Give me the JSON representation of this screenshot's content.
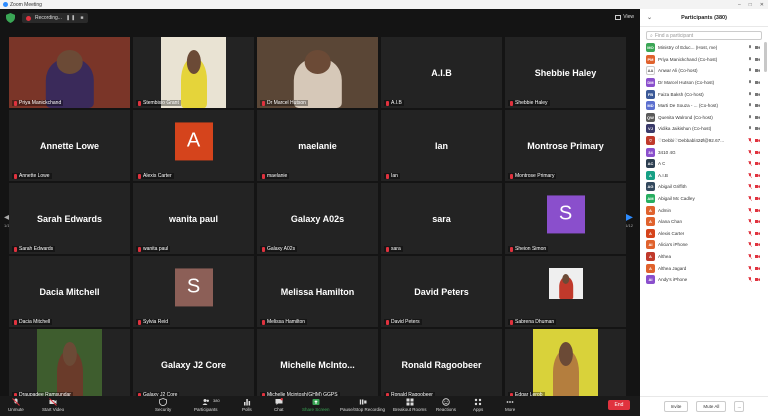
{
  "window": {
    "title": "Zoom Meeting"
  },
  "meeting": {
    "recording_label": "Recording...",
    "view_label": "View",
    "prev_page": "1/12",
    "next_page": "1/12"
  },
  "tiles": [
    {
      "name": "Priya Manickchand",
      "type": "photo",
      "active": true,
      "photo_bg": "#7a3528",
      "photo_fg": "#3a2a5a"
    },
    {
      "name": "Stembisio Grant",
      "type": "photo",
      "photo_bg": "#e9e3d3",
      "photo_fg": "#e5d43a"
    },
    {
      "name": "Dr Marcel Hutson",
      "type": "photo",
      "photo_bg": "#5a4636",
      "photo_fg": "#d6c8b8"
    },
    {
      "name": "A.I.B",
      "big": "A.I.B",
      "type": "text"
    },
    {
      "name": "Shebbie Haley",
      "big": "Shebbie Haley",
      "type": "text"
    },
    {
      "name": "Annette Lowe",
      "big": "Annette Lowe",
      "type": "text"
    },
    {
      "name": "Alexis Carter",
      "type": "avatar",
      "letter": "A",
      "color": "#d5441c"
    },
    {
      "name": "maelanie",
      "big": "maelanie",
      "type": "text"
    },
    {
      "name": "Ian",
      "big": "Ian",
      "type": "text"
    },
    {
      "name": "Montrose Primary",
      "big": "Montrose Primary",
      "type": "text"
    },
    {
      "name": "Sarah Edwards",
      "big": "Sarah Edwards",
      "type": "text"
    },
    {
      "name": "wanita paul",
      "big": "wanita paul",
      "type": "text"
    },
    {
      "name": "Galaxy A02s",
      "big": "Galaxy A02s",
      "type": "text"
    },
    {
      "name": "sara",
      "big": "sara",
      "type": "text"
    },
    {
      "name": "Sheion Simon",
      "type": "avatar",
      "letter": "S",
      "color": "#8a4fcc"
    },
    {
      "name": "Dacia Mitchell",
      "big": "Dacia Mitchell",
      "type": "text"
    },
    {
      "name": "Sylvia Reid",
      "type": "avatar",
      "letter": "S",
      "color": "#8c5f57"
    },
    {
      "name": "Melissa Hamilton",
      "big": "Melissa Hamilton",
      "type": "text"
    },
    {
      "name": "David Peters",
      "big": "David Peters",
      "type": "text"
    },
    {
      "name": "Sabrena Dhuman",
      "type": "photo",
      "photo_bg": "#efefef",
      "photo_fg": "#c0392b",
      "small": true
    },
    {
      "name": "Draupadee Ramsundar",
      "type": "photo",
      "photo_bg": "#3e5d2e",
      "photo_fg": "#6a3b2a"
    },
    {
      "name": "Galaxy J2 Core",
      "big": "Galaxy J2 Core",
      "type": "text"
    },
    {
      "name": "Michelle Mcintosh(GHM) GGPS",
      "big": "Michelle  McInto...",
      "type": "text"
    },
    {
      "name": "Ronald Ragoobeer",
      "big": "Ronald Ragoobeer",
      "type": "text"
    },
    {
      "name": "Edgar Lerob",
      "type": "photo",
      "photo_bg": "#d9d23a",
      "photo_fg": "#b47e3e"
    }
  ],
  "toolbar": {
    "unmute": "Unmute",
    "start_video": "Start Video",
    "security": "Security",
    "participants": "Participants",
    "participants_count": "380",
    "polls": "Polls",
    "chat": "Chat",
    "share_screen": "Share Screen",
    "record": "Pause/Stop Recording",
    "breakout": "Breakout Rooms",
    "reactions": "Reactions",
    "apps": "Apps",
    "more": "More",
    "end": "End"
  },
  "panel": {
    "title": "Participants (380)",
    "search_placeholder": "Find a participant",
    "invite": "Invite",
    "mute_all": "Mute All",
    "more": "...",
    "participants": [
      {
        "initials": "MO",
        "name": "Ministry of Educ... (Host, me)",
        "color": "#3aa655",
        "muted": false
      },
      {
        "initials": "PM",
        "name": "Priya Manickchand (Co-host)",
        "color": "#e0622d",
        "muted": false
      },
      {
        "initials": "AA",
        "name": "Anwar Ali (Co-host)",
        "color": "#ffffff",
        "muted": false
      },
      {
        "initials": "DM",
        "name": "Dr Marcel Hutson (Co-host)",
        "color": "#8a4fcc",
        "muted": false
      },
      {
        "initials": "FB",
        "name": "Faiza Baksh (Co-host)",
        "color": "#3b5998",
        "muted": false
      },
      {
        "initials": "MD",
        "name": "Marti De Souza - ... (Co-host)",
        "color": "#5b6fcf",
        "muted": false
      },
      {
        "initials": "QW",
        "name": "Quenita Walrond (Co-host)",
        "color": "#5a5a5a",
        "muted": false
      },
      {
        "initials": "VJ",
        "name": "Vidika Jaikishun (Co-host)",
        "color": "#3a3a6a",
        "muted": false
      },
      {
        "initials": "♡",
        "name": "♡Debbi♡Debbabl42Ø@92.67...",
        "color": "#c0392b",
        "muted": true
      },
      {
        "initials": "34",
        "name": "3410 4G",
        "color": "#8a4fcc",
        "muted": true
      },
      {
        "initials": "AC",
        "name": "A C",
        "color": "#2c3e50",
        "muted": true
      },
      {
        "initials": "A",
        "name": "A.I.B",
        "color": "#16a085",
        "muted": true
      },
      {
        "initials": "AG",
        "name": "Abigail Griffith",
        "color": "#34495e",
        "muted": true
      },
      {
        "initials": "AM",
        "name": "Abigail Mc Cadley",
        "color": "#27ae60",
        "muted": true
      },
      {
        "initials": "A",
        "name": "Admin",
        "color": "#e0622d",
        "muted": true
      },
      {
        "initials": "A",
        "name": "Alana Chan",
        "color": "#e0622d",
        "muted": true
      },
      {
        "initials": "A",
        "name": "Alexis Carter",
        "color": "#d5441c",
        "muted": true
      },
      {
        "initials": "AI",
        "name": "Alicia's iPhone",
        "color": "#e0622d",
        "muted": true
      },
      {
        "initials": "A",
        "name": "Althea",
        "color": "#c0392b",
        "muted": true
      },
      {
        "initials": "A",
        "name": "Althea Jagard",
        "color": "#e0622d",
        "muted": true
      },
      {
        "initials": "AI",
        "name": "Andy's iPhone",
        "color": "#8a4fcc",
        "muted": true
      }
    ]
  },
  "colors": {
    "accent": "#2d8cff",
    "muted": "#e0323e",
    "active_speaker": "#d3d32c"
  }
}
